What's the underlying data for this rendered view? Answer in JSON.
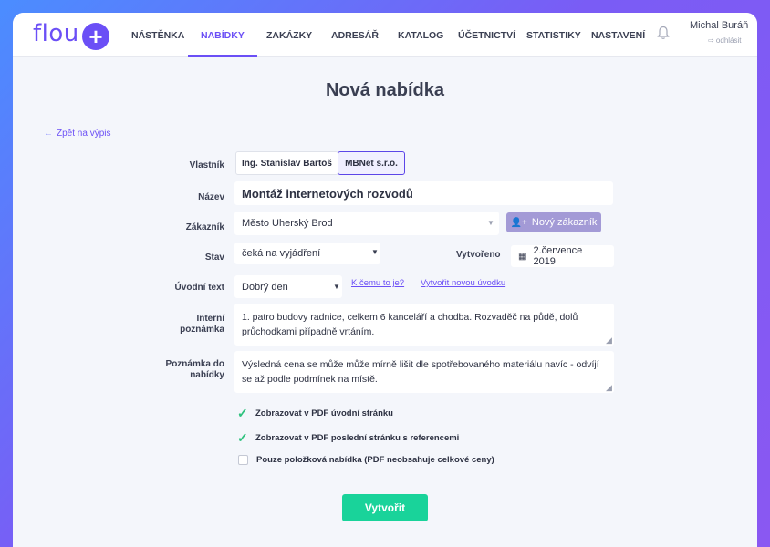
{
  "app": {
    "logo_text": "flou",
    "logo_plus": "+",
    "accent_color": "#6b4ff6"
  },
  "nav": {
    "items": [
      {
        "label": "NÁSTĚNKA"
      },
      {
        "label": "NABÍDKY",
        "active": true
      },
      {
        "label": "ZAKÁZKY"
      },
      {
        "label": "ADRESÁŘ"
      },
      {
        "label": "KATALOG"
      },
      {
        "label": "ÚČETNICTVÍ"
      },
      {
        "label": "STATISTIKY"
      },
      {
        "label": "NASTAVENÍ"
      }
    ],
    "bell_icon": "bell-icon"
  },
  "user": {
    "name": "Michal Buráň",
    "logout_label": "⇨ odhlásit"
  },
  "page": {
    "title": "Nová nabídka",
    "back_link": "Zpět na výpis"
  },
  "form": {
    "owner": {
      "label": "Vlastník",
      "options": [
        "Ing. Stanislav Bartoš",
        "MBNet s.r.o."
      ],
      "selected": "MBNet s.r.o."
    },
    "name": {
      "label": "Název",
      "value": "Montáž internetových rozvodů"
    },
    "customer": {
      "label": "Zákazník",
      "value": "Město Uherský Brod",
      "new_button": "Nový zákazník"
    },
    "status": {
      "label": "Stav",
      "value": "čeká na vyjádření"
    },
    "created": {
      "label": "Vytvořeno",
      "value": "2.července 2019"
    },
    "intro": {
      "label": "Úvodní text",
      "value": "Dobrý den",
      "help_link": "K čemu to je?",
      "new_link": "Vytvořit novou úvodku"
    },
    "internal_note": {
      "label_line1": "Interní",
      "label_line2": "poznámka",
      "value": "1. patro budovy radnice, celkem 6 kanceláří a chodba. Rozvaděč na půdě, dolů průchodkami případně vrtáním."
    },
    "offer_note": {
      "label_line1": "Poznámka do",
      "label_line2": "nabídky",
      "value": "Výsledná cena se může může mírně lišit dle spotřebovaného materiálu navíc - odvíjí se až podle podmínek na místě."
    },
    "checks": [
      {
        "label": "Zobrazovat v PDF úvodní stránku",
        "checked": true
      },
      {
        "label": "Zobrazovat v PDF poslední stránku s referencemi",
        "checked": true
      },
      {
        "label": "Pouze položková nabídka (PDF neobsahuje celkové ceny)",
        "checked": false
      }
    ],
    "submit_label": "Vytvořit"
  }
}
